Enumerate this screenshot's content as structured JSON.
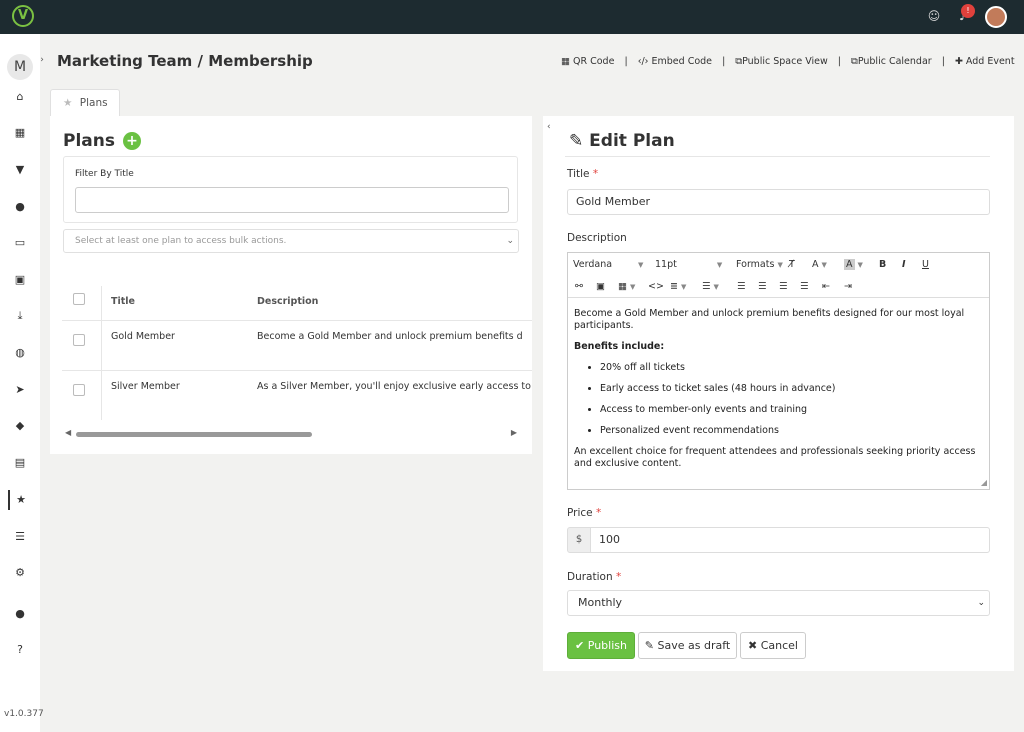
{
  "app": {
    "logo_text": "V",
    "notif_badge": "!",
    "version": "v1.0.377",
    "space_avatar": "M"
  },
  "sidebar": {
    "items": [
      {
        "icon": "home-icon",
        "glyph": "⌂"
      },
      {
        "icon": "calendar-icon",
        "glyph": "▦"
      },
      {
        "icon": "filter-icon",
        "glyph": "▼"
      },
      {
        "icon": "location-pin-icon",
        "glyph": "●"
      },
      {
        "icon": "monitor-icon",
        "glyph": "▭"
      },
      {
        "icon": "image-icon",
        "glyph": "▣"
      },
      {
        "icon": "download-icon",
        "glyph": "⤓"
      },
      {
        "icon": "globe-icon",
        "glyph": "◍"
      },
      {
        "icon": "paper-plane-icon",
        "glyph": "➤"
      },
      {
        "icon": "tags-icon",
        "glyph": "◆"
      },
      {
        "icon": "id-card-icon",
        "glyph": "▤"
      },
      {
        "icon": "star-icon",
        "glyph": "★",
        "active": true
      },
      {
        "icon": "list-icon",
        "glyph": "☰"
      },
      {
        "icon": "cogs-icon",
        "glyph": "⚙"
      },
      {
        "icon": "user-icon",
        "glyph": "●"
      },
      {
        "icon": "help-icon",
        "glyph": "?"
      }
    ]
  },
  "header": {
    "title": "Marketing Team / Membership",
    "actions": {
      "qr": "QR Code",
      "embed": "Embed Code",
      "public_space": "Public Space View",
      "public_calendar": "Public Calendar",
      "add_event": "Add Event"
    },
    "separator": "|"
  },
  "tabs": {
    "plans": "Plans"
  },
  "plans_panel": {
    "heading": "Plans",
    "add_icon": "+",
    "filter_label": "Filter By Title",
    "filter_value": "",
    "bulk_placeholder": "Select at least one plan to access bulk actions.",
    "columns": {
      "title": "Title",
      "description": "Description"
    },
    "rows": [
      {
        "title": "Gold Member",
        "description": "Become a Gold Member and unlock premium benefits d"
      },
      {
        "title": "Silver Member",
        "description": "As a Silver Member, you'll enjoy exclusive early access to"
      }
    ]
  },
  "edit_panel": {
    "heading": "Edit Plan",
    "title_label": "Title",
    "required_mark": "*",
    "title_value": "Gold Member",
    "description_label": "Description",
    "toolbar": {
      "font": "Verdana",
      "size": "11pt",
      "formats": "Formats",
      "clear": "T̸",
      "text_color": "A",
      "bg_color": "A",
      "bold": "B",
      "italic": "I",
      "underline": "U",
      "code": "<>"
    },
    "content": {
      "intro": "Become a Gold Member and unlock premium benefits designed for our most loyal participants.",
      "benefits_heading": "Benefits include:",
      "benefits": [
        "20% off all tickets",
        "Early access to ticket sales (48 hours in advance)",
        "Access to member-only events and training",
        "Personalized event recommendations"
      ],
      "closing": "An excellent choice for frequent attendees and professionals seeking priority access and exclusive content."
    },
    "price_label": "Price",
    "price_prefix": "$",
    "price_value": "100",
    "duration_label": "Duration",
    "duration_value": "Monthly",
    "buttons": {
      "publish": "Publish",
      "draft": "Save as draft",
      "cancel": "Cancel"
    }
  }
}
